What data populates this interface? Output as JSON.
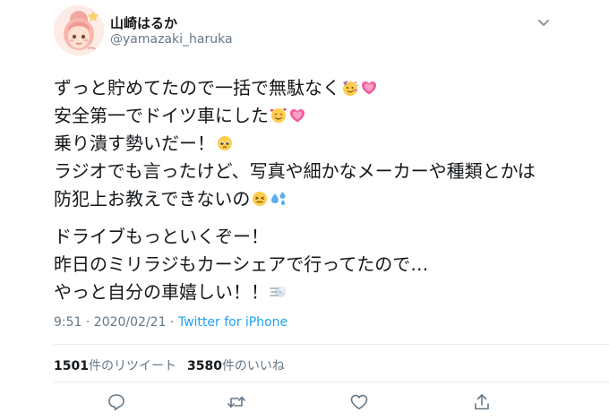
{
  "tweet": {
    "display_name": "山崎はるか",
    "handle": "@yamazaki_haruka",
    "paragraphs": [
      [
        {
          "text": "ずっと貯めてたので一括で無駄なく",
          "emojis": [
            "partying-face-emoji",
            "growing-heart-emoji"
          ]
        },
        {
          "text": "安全第一でドイツ車にした",
          "emojis": [
            "smiling-face-with-hearts-emoji",
            "growing-heart-emoji"
          ]
        },
        {
          "text": "乗り潰す勢いだー！",
          "emojis": [
            "pleading-face-emoji"
          ]
        },
        {
          "text": "ラジオでも言ったけど、写真や細かなメーカーや種類とかは",
          "emojis": []
        },
        {
          "text": "防犯上お教えできないの",
          "emojis": [
            "persevering-face-emoji",
            "sweat-droplets-emoji"
          ]
        }
      ],
      [
        {
          "text": "ドライブもっといくぞー！",
          "emojis": []
        },
        {
          "text": "昨日のミリラジもカーシェアで行ってたので…",
          "emojis": []
        },
        {
          "text": "やっと自分の車嬉しい！！",
          "emojis": [
            "dashing-away-emoji"
          ]
        }
      ]
    ],
    "time": "9:51 · 2020/02/21 · ",
    "source": "Twitter for iPhone",
    "retweet_count": "1501",
    "retweet_label": "件のリツイート",
    "like_count": "3580",
    "like_label": "件のいいね"
  },
  "icons": {
    "caret": "chevron-down-icon",
    "reply": "reply-icon",
    "retweet": "retweet-icon",
    "like": "heart-icon",
    "share": "share-icon"
  },
  "colors": {
    "text": "#14171a",
    "secondary": "#657786",
    "link": "#1da1f2",
    "divider": "#e6ecf0",
    "heart_emoji": "#f25c9c",
    "face_emoji": "#ffcc4d"
  }
}
